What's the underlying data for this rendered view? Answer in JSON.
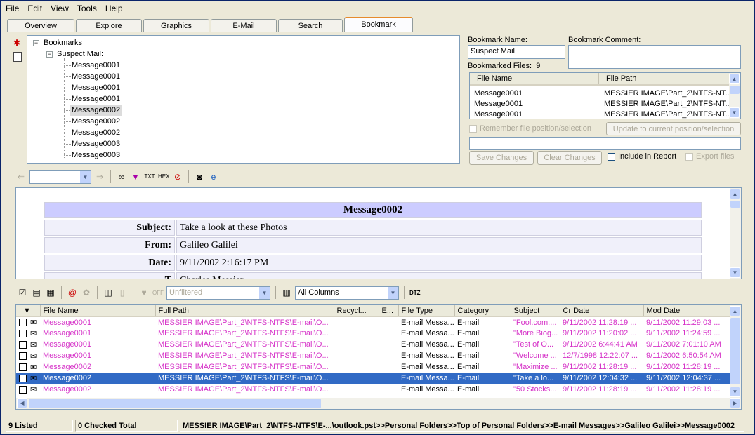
{
  "menu": [
    "File",
    "Edit",
    "View",
    "Tools",
    "Help"
  ],
  "tabs": [
    {
      "label": "Overview"
    },
    {
      "label": "Explore"
    },
    {
      "label": "Graphics"
    },
    {
      "label": "E-Mail"
    },
    {
      "label": "Search"
    },
    {
      "label": "Bookmark"
    }
  ],
  "tree": {
    "root": "Bookmarks",
    "folder": "Suspect Mail:",
    "items": [
      "Message0001",
      "Message0001",
      "Message0001",
      "Message0001",
      "Message0002",
      "Message0002",
      "Message0002",
      "Message0003",
      "Message0003"
    ]
  },
  "bookmark": {
    "name_label": "Bookmark Name:",
    "name_value": "Suspect Mail",
    "comment_label": "Bookmark Comment:",
    "files_label": "Bookmarked Files:",
    "files_count": "9",
    "col_file": "File Name",
    "col_path": "File Path",
    "files": [
      {
        "name": "Message0001",
        "path": "MESSIER IMAGE\\Part_2\\NTFS-NT..."
      },
      {
        "name": "Message0001",
        "path": "MESSIER IMAGE\\Part_2\\NTFS-NT..."
      },
      {
        "name": "Message0001",
        "path": "MESSIER IMAGE\\Part_2\\NTFS-NT..."
      }
    ],
    "remember_label": "Remember file position/selection",
    "update_btn": "Update to current position/selection",
    "save_btn": "Save Changes",
    "clear_btn": "Clear Changes",
    "include_label": "Include in Report",
    "export_label": "Export files"
  },
  "viewer_toolbar": {
    "icons": [
      "back-icon",
      "forward-icon",
      "glasses-icon",
      "filter-icon",
      "text-icon",
      "hex-icon",
      "no-sign-icon",
      "camera-icon",
      "ie-icon"
    ]
  },
  "preview": {
    "title": "Message0002",
    "rows": [
      {
        "k": "Subject:",
        "v": "Take a look at these Photos"
      },
      {
        "k": "From:",
        "v": "Galileo Galilei"
      },
      {
        "k": "Date:",
        "v": "9/11/2002 2:16:17 PM"
      },
      {
        "k": "T",
        "v": "Charles Messier"
      }
    ]
  },
  "list_toolbar": {
    "off_label": "OFF",
    "filter_value": "Unfiltered",
    "columns_value": "All Columns",
    "dtz_label": "DTZ"
  },
  "grid": {
    "columns": [
      "File Name",
      "Full Path",
      "Recycl...",
      "E...",
      "File Type",
      "Category",
      "Subject",
      "Cr Date",
      "Mod Date"
    ],
    "rows": [
      [
        "Message0001",
        "MESSIER IMAGE\\Part_2\\NTFS-NTFS\\E-mail\\O...",
        "",
        "",
        "E-mail Messa...",
        "E-mail",
        "\"Fool.com:...",
        "9/11/2002 11:28:19 ...",
        "9/11/2002 11:29:03 ..."
      ],
      [
        "Message0001",
        "MESSIER IMAGE\\Part_2\\NTFS-NTFS\\E-mail\\O...",
        "",
        "",
        "E-mail Messa...",
        "E-mail",
        "\"More Biog...",
        "9/11/2002 11:20:02 ...",
        "9/11/2002 11:24:59 ..."
      ],
      [
        "Message0001",
        "MESSIER IMAGE\\Part_2\\NTFS-NTFS\\E-mail\\O...",
        "",
        "",
        "E-mail Messa...",
        "E-mail",
        "\"Test of O...",
        "9/11/2002 6:44:41 AM",
        "9/11/2002 7:01:10 AM"
      ],
      [
        "Message0001",
        "MESSIER IMAGE\\Part_2\\NTFS-NTFS\\E-mail\\O...",
        "",
        "",
        "E-mail Messa...",
        "E-mail",
        "\"Welcome ...",
        "12/7/1998 12:22:07 ...",
        "9/11/2002 6:50:54 AM"
      ],
      [
        "Message0002",
        "MESSIER IMAGE\\Part_2\\NTFS-NTFS\\E-mail\\O...",
        "",
        "",
        "E-mail Messa...",
        "E-mail",
        "\"Maximize ...",
        "9/11/2002 11:28:19 ...",
        "9/11/2002 11:28:19 ..."
      ],
      [
        "Message0002",
        "MESSIER IMAGE\\Part_2\\NTFS-NTFS\\E-mail\\O...",
        "",
        "",
        "E-mail Messa...",
        "E-mail",
        "\"Take a lo...",
        "9/11/2002 12:04:32 ...",
        "9/11/2002 12:04:37 ..."
      ],
      [
        "Message0002",
        "MESSIER IMAGE\\Part_2\\NTFS-NTFS\\E-mail\\O...",
        "",
        "",
        "E-mail Messa...",
        "E-mail",
        "\"50 Stocks...",
        "9/11/2002 11:28:19 ...",
        "9/11/2002 11:28:19 ..."
      ]
    ],
    "selected_row": 5
  },
  "status": {
    "listed": "9 Listed",
    "checked": "0 Checked Total",
    "path": "MESSIER IMAGE\\Part_2\\NTFS-NTFS\\E-...\\outlook.pst>>Personal Folders>>Top of Personal Folders>>E-mail Messages>>Galileo Galilei>>Message0002"
  },
  "colors": {
    "accent": "#316ac5",
    "link": "#d633c8",
    "tab_highlight": "#e68b2c"
  }
}
